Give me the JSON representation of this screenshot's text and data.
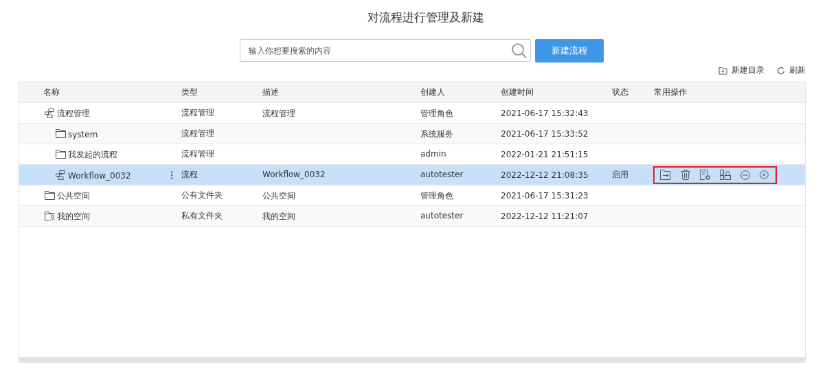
{
  "title": "对流程进行管理及新建",
  "search": {
    "placeholder": "输入你想要搜索的内容"
  },
  "new_button": "新建流程",
  "toolbar": [
    {
      "kind": "new-folder",
      "label": "新建目录"
    },
    {
      "kind": "refresh",
      "label": "刷新"
    }
  ],
  "table": {
    "columns": [
      "名称",
      "类型",
      "描述",
      "创建人",
      "创建时间",
      "状态",
      "常用操作"
    ],
    "rows": [
      {
        "kind": "flow",
        "name": "流程管理",
        "type": "流程管理",
        "description": "流程管理",
        "creator": "管理角色",
        "created": "2021-06-17 15:32:43",
        "selected": false,
        "children": [
          {
            "kind": "folder",
            "name": "system",
            "type": "流程管理",
            "creator": "系统服务",
            "created": "2021-06-17 15:33:52",
            "selected": false
          },
          {
            "kind": "folder",
            "name": "我发起的流程",
            "type": "流程管理",
            "creator": "admin",
            "created": "2022-01-21 21:51:15",
            "selected": false
          },
          {
            "kind": "flow",
            "name": "Workflow_0032",
            "type": "流程",
            "description": "Workflow_0032",
            "creator": "autotester",
            "created": "2022-12-12 21:08:35",
            "status": "启用",
            "selected": true
          }
        ]
      },
      {
        "kind": "folder",
        "name": "公共空间",
        "type": "公有文件夹",
        "description": "公共空间",
        "creator": "管理角色",
        "created": "2021-06-17 15:31:23",
        "selected": false
      },
      {
        "kind": "user-folder",
        "name": "我的空间",
        "type": "私有文件夹",
        "description": "我的空间",
        "creator": "autotester",
        "created": "2022-12-12 11:21:07",
        "selected": false
      }
    ]
  }
}
